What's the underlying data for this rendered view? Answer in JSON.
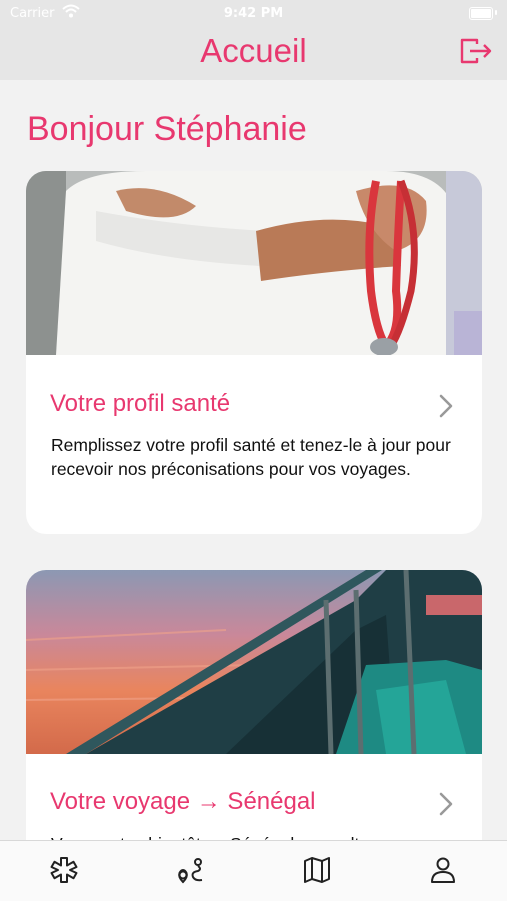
{
  "status_bar": {
    "carrier": "Carrier",
    "time": "9:42 PM"
  },
  "nav": {
    "title": "Accueil",
    "logout_icon": "logout-icon"
  },
  "greeting": "Bonjour Stéphanie",
  "cards": [
    {
      "title": "Votre profil santé",
      "text": "Remplissez votre profil santé et tenez-le à jour pour recevoir nos préconisations pour vos voyages.",
      "image": "doctor-with-stethoscope-photo"
    },
    {
      "title": "Votre voyage → Sénégal",
      "text": "Vous partez bientôt au Sénégal, consultez nos",
      "image": "boat-on-pink-lake-photo"
    }
  ],
  "tabs": [
    {
      "icon": "medical-star-icon"
    },
    {
      "icon": "route-icon"
    },
    {
      "icon": "map-icon"
    },
    {
      "icon": "profile-icon"
    }
  ],
  "colors": {
    "accent": "#e8386f",
    "bar": "#e6e6e6",
    "background": "#f2f2f2"
  }
}
